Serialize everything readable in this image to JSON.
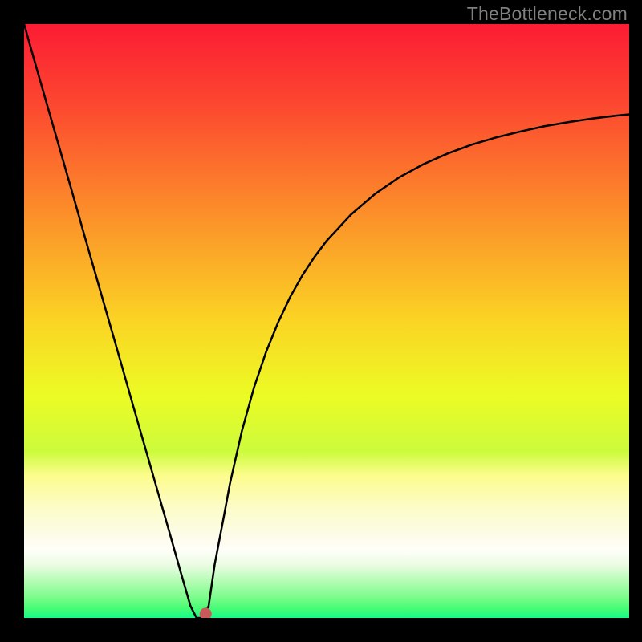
{
  "watermark": "TheBottleneck.com",
  "chart_data": {
    "type": "line",
    "title": "",
    "xlabel": "",
    "ylabel": "",
    "xlim": [
      0.0,
      1.0
    ],
    "ylim": [
      0.0,
      1.0
    ],
    "x": [
      0.0,
      0.02,
      0.04,
      0.06,
      0.08,
      0.1,
      0.12,
      0.14,
      0.16,
      0.18,
      0.2,
      0.22,
      0.24,
      0.26,
      0.275,
      0.285,
      0.295,
      0.305,
      0.315,
      0.33,
      0.34,
      0.36,
      0.38,
      0.4,
      0.42,
      0.44,
      0.46,
      0.48,
      0.5,
      0.54,
      0.58,
      0.62,
      0.66,
      0.7,
      0.74,
      0.78,
      0.82,
      0.86,
      0.9,
      0.94,
      0.98,
      1.0
    ],
    "values": [
      1.0,
      0.928,
      0.857,
      0.786,
      0.715,
      0.643,
      0.572,
      0.501,
      0.43,
      0.358,
      0.287,
      0.216,
      0.145,
      0.073,
      0.02,
      0.0,
      0.0,
      0.02,
      0.09,
      0.17,
      0.225,
      0.315,
      0.388,
      0.448,
      0.498,
      0.541,
      0.577,
      0.608,
      0.635,
      0.679,
      0.714,
      0.742,
      0.764,
      0.782,
      0.797,
      0.809,
      0.819,
      0.828,
      0.835,
      0.841,
      0.846,
      0.848
    ],
    "marker_point": {
      "x": 0.3,
      "y": 0.007,
      "color": "#c95a5a"
    },
    "gradient_stops": [
      {
        "offset": 0.0,
        "color": "#fc1c34"
      },
      {
        "offset": 0.125,
        "color": "#fc4430"
      },
      {
        "offset": 0.25,
        "color": "#fc742c"
      },
      {
        "offset": 0.375,
        "color": "#fba428"
      },
      {
        "offset": 0.5,
        "color": "#fbd424"
      },
      {
        "offset": 0.625,
        "color": "#ecfb24"
      },
      {
        "offset": 0.72,
        "color": "#ccfb3c"
      },
      {
        "offset": 0.76,
        "color": "#fcfc8c"
      },
      {
        "offset": 0.81,
        "color": "#fcfcc4"
      },
      {
        "offset": 0.86,
        "color": "#fcfce8"
      },
      {
        "offset": 0.885,
        "color": "#fffef9"
      },
      {
        "offset": 0.91,
        "color": "#ecfce4"
      },
      {
        "offset": 0.938,
        "color": "#b4fcb4"
      },
      {
        "offset": 0.965,
        "color": "#7cfc8c"
      },
      {
        "offset": 0.985,
        "color": "#44fc74"
      },
      {
        "offset": 1.0,
        "color": "#14fc8c"
      }
    ]
  }
}
